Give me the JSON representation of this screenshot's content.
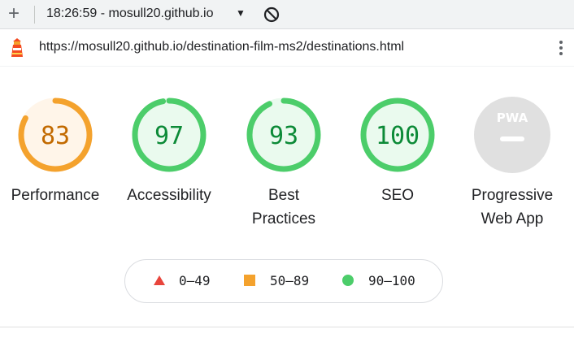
{
  "toolbar": {
    "new_tab_label": "+",
    "title": "18:26:59 - mosull20.github.io",
    "caret": "▼"
  },
  "urlbar": {
    "url": "https://mosull20.github.io/destination-film-ms2/destinations.html"
  },
  "gauges": [
    {
      "label_line1": "Performance",
      "label_line2": "",
      "score": "83",
      "fraction": 0.83,
      "status": "average"
    },
    {
      "label_line1": "Accessibility",
      "label_line2": "",
      "score": "97",
      "fraction": 0.97,
      "status": "pass"
    },
    {
      "label_line1": "Best",
      "label_line2": "Practices",
      "score": "93",
      "fraction": 0.93,
      "status": "pass"
    },
    {
      "label_line1": "SEO",
      "label_line2": "",
      "score": "100",
      "fraction": 1.0,
      "status": "pass"
    },
    {
      "label_line1": "Progressive",
      "label_line2": "Web App",
      "badge": "PWA",
      "status": "na"
    }
  ],
  "legend": [
    {
      "range": "0–49",
      "shape": "triangle",
      "color": "#e8453c"
    },
    {
      "range": "50–89",
      "shape": "square",
      "color": "#f4a22d"
    },
    {
      "range": "90–100",
      "shape": "circle",
      "color": "#4ccd6a"
    }
  ],
  "colors": {
    "pass": "#4ccd6a",
    "pass_fill": "#eafaee",
    "pass_text": "#0c8a37",
    "average": "#f4a22d",
    "average_fill": "#fff5e9",
    "average_text": "#c26a00",
    "na": "#e0e0e0"
  }
}
